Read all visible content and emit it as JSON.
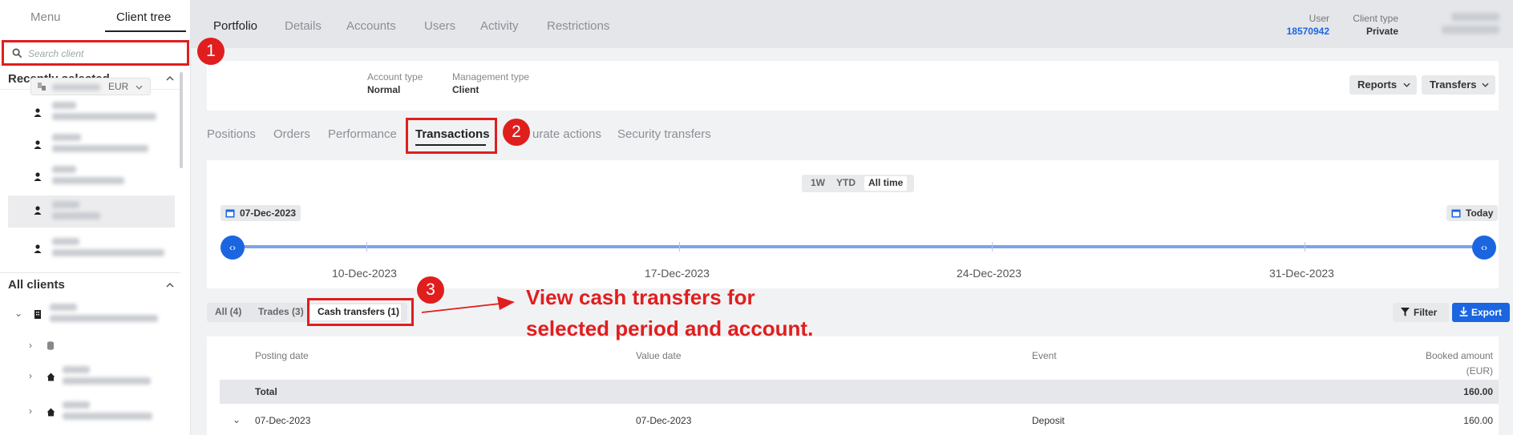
{
  "sidebar": {
    "tabs": [
      "Menu",
      "Client tree"
    ],
    "search_placeholder": "Search client",
    "recently_selected_label": "Recently selected",
    "all_clients_label": "All clients"
  },
  "topbar": {
    "tabs": [
      "Portfolio",
      "Details",
      "Accounts",
      "Users",
      "Activity",
      "Restrictions"
    ],
    "user_label": "User",
    "user_value": "18570942",
    "client_type_label": "Client type",
    "client_type_value": "Private"
  },
  "account": {
    "currency": "EUR",
    "account_type_label": "Account type",
    "account_type_value": "Normal",
    "management_type_label": "Management type",
    "management_type_value": "Client",
    "reports_label": "Reports",
    "transfers_label": "Transfers"
  },
  "subtabs": [
    "Positions",
    "Orders",
    "Performance",
    "Transactions",
    "urate actions",
    "Security transfers"
  ],
  "period": {
    "options": [
      "1W",
      "YTD",
      "All time"
    ],
    "start_date": "07-Dec-2023",
    "end_label": "Today",
    "ticks": [
      "10-Dec-2023",
      "17-Dec-2023",
      "24-Dec-2023",
      "31-Dec-2023"
    ]
  },
  "filters": {
    "tabs": [
      "All (4)",
      "Trades (3)",
      "Cash transfers (1)"
    ],
    "filter_label": "Filter",
    "export_label": "Export"
  },
  "annotation": {
    "badges": [
      "1",
      "2",
      "3"
    ],
    "line1": "View cash transfers for",
    "line2": "selected period and account.",
    "color": "#e01e1e"
  },
  "table": {
    "headers": [
      "Posting date",
      "Value date",
      "Event",
      "Booked amount",
      "(EUR)"
    ],
    "total_label": "Total",
    "total_value": "160.00",
    "rows": [
      {
        "posting_date": "07-Dec-2023",
        "value_date": "07-Dec-2023",
        "event": "Deposit",
        "amount": "160.00"
      }
    ]
  },
  "colors": {
    "accent_blue": "#1b66e0",
    "highlight_red": "#e01e1e"
  }
}
